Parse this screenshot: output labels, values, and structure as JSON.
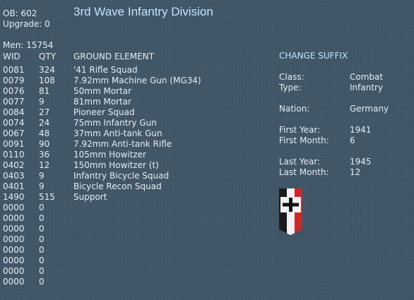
{
  "header": {
    "ob": "OB: 602",
    "upgrade": "Upgrade: 0",
    "title": "3rd Wave Infantry Division",
    "men": "Men: 15754"
  },
  "table": {
    "columns": {
      "wid": "WID",
      "qty": "QTY",
      "element": "GROUND ELEMENT"
    },
    "rows": [
      {
        "wid": "0081",
        "qty": "324",
        "name": "'41 Rifle Squad"
      },
      {
        "wid": "0079",
        "qty": "108",
        "name": "7.92mm Machine Gun (MG34)"
      },
      {
        "wid": "0076",
        "qty": "81",
        "name": "50mm Mortar"
      },
      {
        "wid": "0077",
        "qty": "9",
        "name": "81mm Mortar"
      },
      {
        "wid": "0084",
        "qty": "27",
        "name": "Pioneer Squad"
      },
      {
        "wid": "0074",
        "qty": "24",
        "name": "75mm Infantry Gun"
      },
      {
        "wid": "0067",
        "qty": "48",
        "name": "37mm Anti-tank Gun"
      },
      {
        "wid": "0091",
        "qty": "90",
        "name": "7.92mm Anti-tank Rifle"
      },
      {
        "wid": "0110",
        "qty": "36",
        "name": "105mm Howitzer"
      },
      {
        "wid": "0402",
        "qty": "12",
        "name": "150mm Howitzer (t)"
      },
      {
        "wid": "0403",
        "qty": "9",
        "name": "Infantry Bicycle Squad"
      },
      {
        "wid": "0401",
        "qty": "9",
        "name": "Bicycle Recon Squad"
      },
      {
        "wid": "1490",
        "qty": "515",
        "name": "Support"
      },
      {
        "wid": "0000",
        "qty": "0",
        "name": ""
      },
      {
        "wid": "0000",
        "qty": "0",
        "name": ""
      },
      {
        "wid": "0000",
        "qty": "0",
        "name": ""
      },
      {
        "wid": "0000",
        "qty": "0",
        "name": ""
      },
      {
        "wid": "0000",
        "qty": "0",
        "name": ""
      },
      {
        "wid": "0000",
        "qty": "0",
        "name": ""
      },
      {
        "wid": "0000",
        "qty": "0",
        "name": ""
      },
      {
        "wid": "0000",
        "qty": "0",
        "name": ""
      }
    ]
  },
  "info": {
    "change_suffix": "CHANGE SUFFIX",
    "class_label": "Class:",
    "class_value": "Combat",
    "type_label": "Type:",
    "type_value": "Infantry",
    "nation_label": "Nation:",
    "nation_value": "Germany",
    "first_year_label": "First Year:",
    "first_year_value": "1941",
    "first_month_label": "First Month:",
    "first_month_value": "6",
    "last_year_label": "Last Year:",
    "last_year_value": "1945",
    "last_month_label": "Last Month:",
    "last_month_value": "12",
    "flag_icon": "german-war-flag-icon"
  },
  "colors": {
    "background": "#3f5566",
    "title": "#bfe6ff",
    "text": "#e6edf2"
  }
}
